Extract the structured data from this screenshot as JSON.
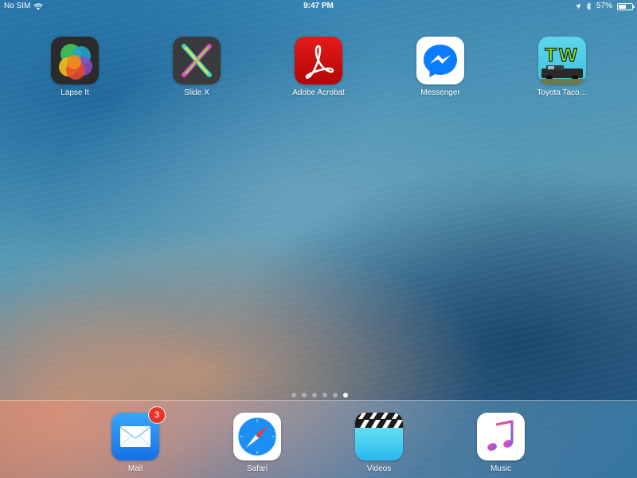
{
  "status_bar": {
    "carrier": "No SIM",
    "time": "9:47 PM",
    "battery_percent": "57%",
    "battery_level": 0.57,
    "icons": [
      "wifi-icon",
      "location-arrow-icon",
      "bluetooth-icon",
      "battery-icon"
    ]
  },
  "home": {
    "apps": [
      {
        "label": "Lapse It",
        "icon": "lapse-it-icon"
      },
      {
        "label": "Slide X",
        "icon": "slide-x-icon"
      },
      {
        "label": "Adobe Acrobat",
        "icon": "adobe-acrobat-icon"
      },
      {
        "label": "Messenger",
        "icon": "messenger-icon"
      },
      {
        "label": "Toyota Taco…",
        "icon": "toyota-taco-icon",
        "icon_text": "TW"
      }
    ]
  },
  "page_indicator": {
    "pages": 6,
    "current": 6
  },
  "dock": {
    "apps": [
      {
        "label": "Mail",
        "icon": "mail-icon",
        "badge": "3"
      },
      {
        "label": "Safari",
        "icon": "safari-icon"
      },
      {
        "label": "Videos",
        "icon": "videos-icon"
      },
      {
        "label": "Music",
        "icon": "music-icon"
      }
    ]
  },
  "colors": {
    "badge": "#e8362f",
    "acrobat_red": "#d30d0d",
    "messenger_blue": "#0a7cff",
    "mail_blue": "#1e8bf0",
    "tw_cyan": "#4fd0e8",
    "tw_green": "#7ef02c"
  }
}
